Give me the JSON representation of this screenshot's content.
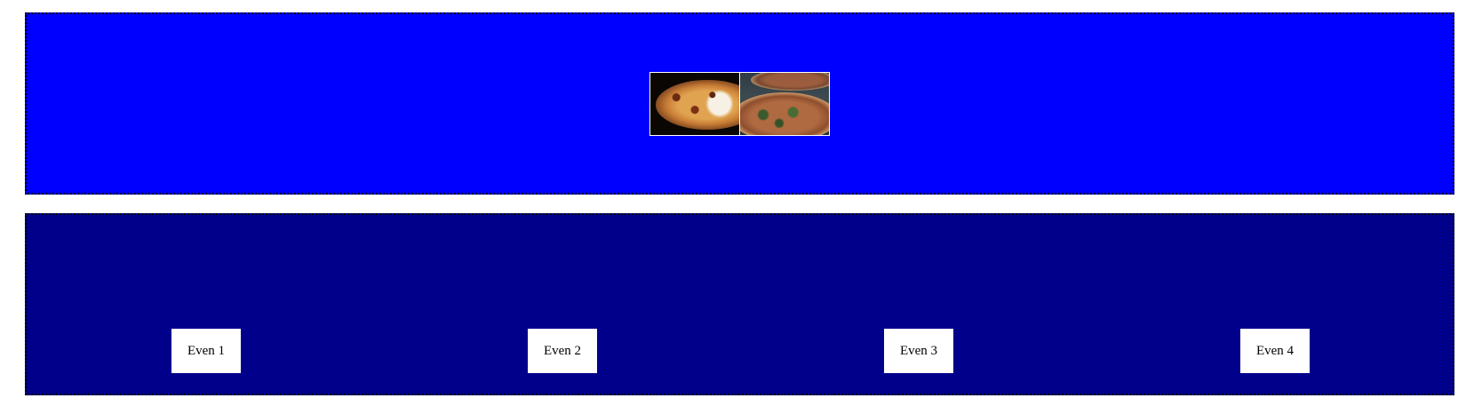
{
  "colors": {
    "page_background": "#ffffff",
    "top_panel_background": "#0000ff",
    "bottom_panel_background": "#00008b",
    "panel_border": "#000000",
    "box_background": "#ffffff"
  },
  "top_panel": {
    "images": [
      {
        "name": "pizza-photo-1"
      },
      {
        "name": "pizza-photo-2"
      }
    ]
  },
  "bottom_panel": {
    "boxes": [
      {
        "label": "Even 1"
      },
      {
        "label": "Even 2"
      },
      {
        "label": "Even 3"
      },
      {
        "label": "Even 4"
      }
    ]
  }
}
